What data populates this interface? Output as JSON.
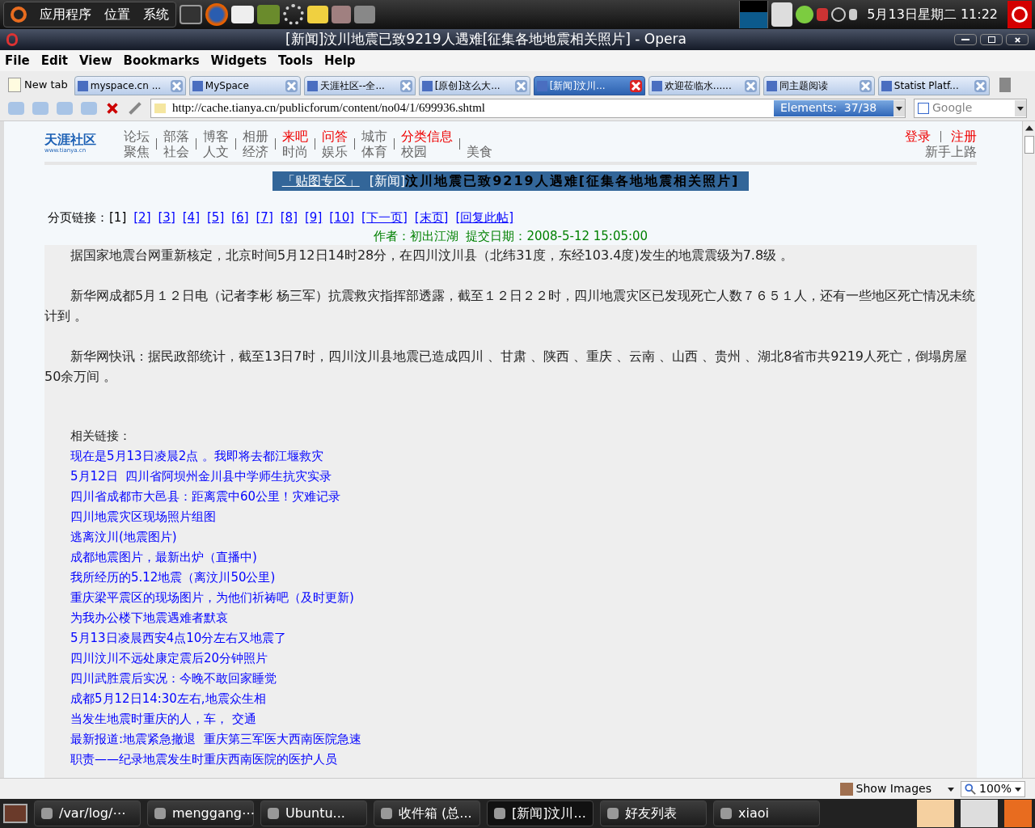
{
  "top_panel": {
    "menus": [
      "应用程序",
      "位置",
      "系统"
    ],
    "clock": "5月13日星期二 11:22"
  },
  "window": {
    "title": "[新闻]汶川地震已致9219人遇难[征集各地地震相关照片] - Opera"
  },
  "menu_bar": [
    "File",
    "Edit",
    "View",
    "Bookmarks",
    "Widgets",
    "Tools",
    "Help"
  ],
  "new_tab": "New tab",
  "tabs": [
    {
      "label": "myspace.cn ...",
      "selected": false
    },
    {
      "label": "MySpace",
      "selected": false
    },
    {
      "label": "天涯社区--全...",
      "selected": false
    },
    {
      "label": "[原创]这么大...",
      "selected": false
    },
    {
      "label": "[新闻]汶川...",
      "selected": true
    },
    {
      "label": "欢迎莅临水......",
      "selected": false
    },
    {
      "label": "同主题阅读",
      "selected": false
    },
    {
      "label": "Statist Platf...",
      "selected": false
    }
  ],
  "address_bar": {
    "url": "http://cache.tianya.cn/publicforum/content/no04/1/699936.shtml",
    "elements": "Elements:  37/38",
    "search_placeholder": "Google"
  },
  "page": {
    "logo": {
      "name": "天涯社区",
      "site": "www.tianya.cn"
    },
    "nav": [
      {
        "top": "论坛",
        "top_highlighted": false,
        "bottom": "聚焦"
      },
      {
        "top": "部落",
        "top_highlighted": false,
        "bottom": "社会"
      },
      {
        "top": "博客",
        "top_highlighted": false,
        "bottom": "人文"
      },
      {
        "top": "相册",
        "top_highlighted": false,
        "bottom": "经济"
      },
      {
        "top": "来吧",
        "top_highlighted": true,
        "bottom": "时尚"
      },
      {
        "top": "问答",
        "top_highlighted": true,
        "bottom": "娱乐"
      },
      {
        "top": "城市",
        "top_highlighted": false,
        "bottom": "体育"
      },
      {
        "top": "分类信息",
        "top_highlighted": true,
        "bottom": "校园"
      },
      {
        "bottom": "美食"
      }
    ],
    "account": {
      "login": "登录",
      "register": "注册",
      "help": "新手上路"
    },
    "title_bar": {
      "section": "「贴图专区」",
      "tag": "[新闻]",
      "headline": "汶川地震已致9219人遇难[征集各地地震相关照片]"
    },
    "pager": {
      "label": "分页链接：",
      "current": "[1]",
      "pages": [
        "[2]",
        "[3]",
        "[4]",
        "[5]",
        "[6]",
        "[7]",
        "[8]",
        "[9]",
        "[10]"
      ],
      "next": "[下一页]",
      "last": "[末页]",
      "reply": "[回复此帖]"
    },
    "byline": "作者：初出江湖  提交日期：2008-5-12 15:05:00",
    "paragraphs": [
      "据国家地震台网重新核定，北京时间5月12日14时28分，在四川汶川县（北纬31度，东经103.4度)发生的地震震级为7.8级 。",
      "新华网成都5月１２日电（记者李彬 杨三军）抗震救灾指挥部透露，截至１２日２２时，四川地震灾区已发现死亡人数７６５１人，还有一些地区死亡情况未统计到 。",
      "新华网快讯：据民政部统计，截至13日7时，四川汶川县地震已造成四川 、甘肃 、陕西 、重庆 、云南 、山西 、贵州 、湖北8省市共9219人死亡，倒塌房屋50余万间 。"
    ],
    "related_label": "相关链接：",
    "related_links": [
      "现在是5月13日凌晨2点 。我即将去都江堰救灾",
      "5月12日  四川省阿坝州金川县中学师生抗灾实录",
      "四川省成都市大邑县：距离震中60公里！灾难记录",
      "四川地震灾区现场照片组图",
      "逃离汶川(地震图片)",
      "成都地震图片，最新出炉（直播中)",
      "我所经历的5.12地震（离汶川50公里)",
      "重庆梁平震区的现场图片，为他们祈祷吧（及时更新)",
      "为我办公楼下地震遇难者默哀",
      "5月13日凌晨西安4点10分左右又地震了",
      "四川汶川不远处康定震后20分钟照片",
      "四川武胜震后实况：今晚不敢回家睡觉",
      "成都5月12日14:30左右,地震众生相",
      "当发生地震时重庆的人，车， 交通",
      "最新报道:地震紧急撤退  重庆第三军医大西南医院急速",
      "职责——纪录地震发生时重庆西南医院的医护人员"
    ]
  },
  "status_bar": {
    "images": "Show Images",
    "zoom": "100%"
  },
  "taskbar": [
    {
      "label": "/var/log/⋯",
      "selected": false
    },
    {
      "label": "menggang⋯",
      "selected": false
    },
    {
      "label": "Ubuntu...",
      "selected": false
    },
    {
      "label": "收件箱 (总...",
      "selected": false
    },
    {
      "label": "[新闻]汶川...",
      "selected": true
    },
    {
      "label": "好友列表",
      "selected": false
    },
    {
      "label": "xiaoi",
      "selected": false
    }
  ]
}
